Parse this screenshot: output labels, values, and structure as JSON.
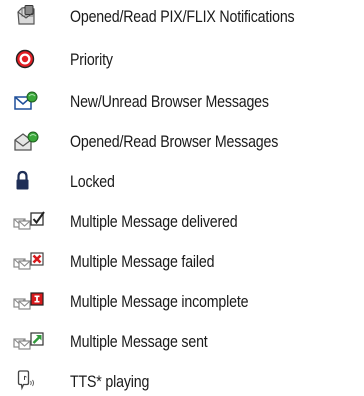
{
  "legend": {
    "items": [
      {
        "icon": "opened-pix-flix-notification-icon",
        "label": "Opened/Read PIX/FLIX Notifications"
      },
      {
        "icon": "priority-icon",
        "label": "Priority"
      },
      {
        "icon": "new-browser-message-icon",
        "label": "New/Unread Browser Messages"
      },
      {
        "icon": "opened-browser-message-icon",
        "label": "Opened/Read Browser Messages"
      },
      {
        "icon": "lock-icon",
        "label": "Locked"
      },
      {
        "icon": "multiple-message-delivered-icon",
        "label": "Multiple Message delivered"
      },
      {
        "icon": "multiple-message-failed-icon",
        "label": "Multiple Message failed"
      },
      {
        "icon": "multiple-message-incomplete-icon",
        "label": "Multiple Message incomplete"
      },
      {
        "icon": "multiple-message-sent-icon",
        "label": "Multiple Message sent"
      },
      {
        "icon": "tts-playing-icon",
        "label": "TTS* playing"
      }
    ]
  },
  "colors": {
    "text": "#1a1a1a",
    "icon_gray": "#8a8a8a",
    "priority_red": "#e31e24",
    "browser_blue": "#1e4f9a",
    "browser_green": "#3aa83a",
    "lock_navy": "#1f2f57",
    "failed_red": "#d7191c",
    "sent_green": "#2f9a3a"
  }
}
